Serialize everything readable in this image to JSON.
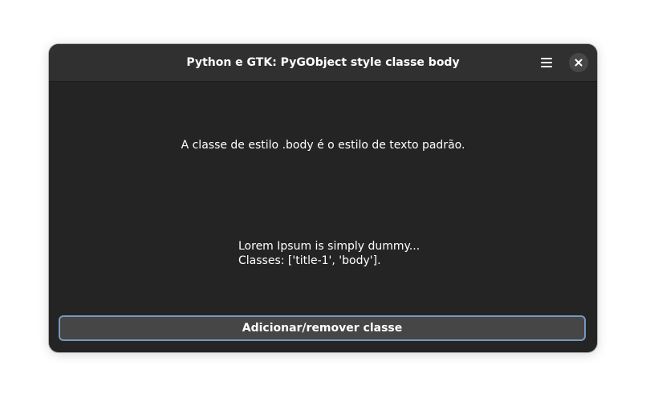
{
  "window": {
    "title": "Python e GTK: PyGObject style classe body"
  },
  "header": {
    "menu_icon": "hamburger-menu-icon",
    "close_icon": "close-icon"
  },
  "content": {
    "body_label": "A classe de estilo .body é o estilo de texto padrão.",
    "lorem_line1": "Lorem Ipsum is simply dummy...",
    "lorem_line2": "Classes: ['title-1', 'body']."
  },
  "actions": {
    "toggle_label": "Adicionar/remover classe"
  },
  "colors": {
    "window_bg": "#242424",
    "header_bg": "#303030",
    "button_bg": "#464646",
    "focus_ring": "#7797bd",
    "text": "#ffffff"
  }
}
